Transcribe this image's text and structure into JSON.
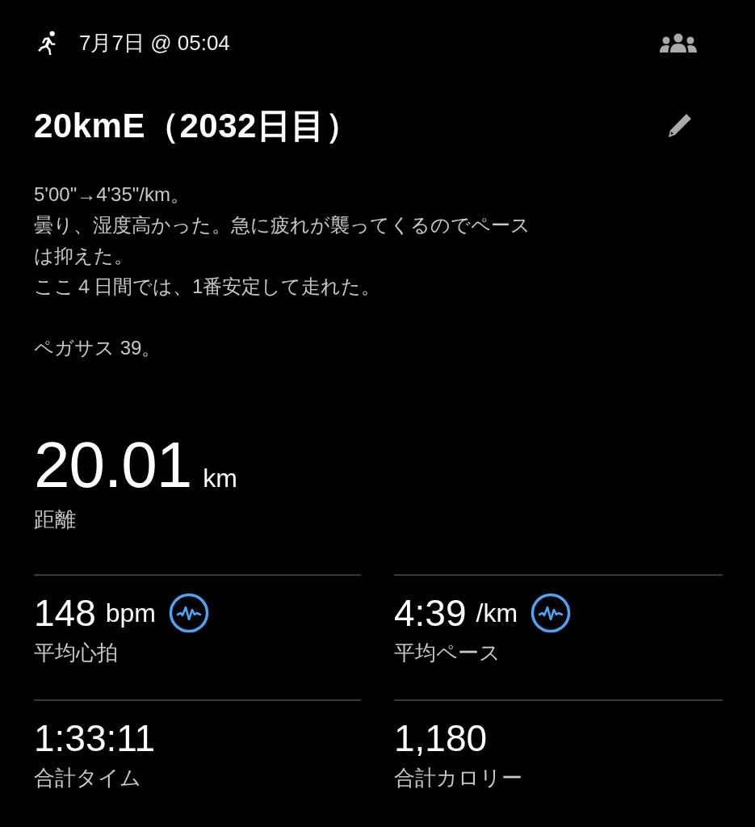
{
  "header": {
    "date": "7月7日 @ 05:04"
  },
  "title": "20kmE（2032日目）",
  "notes": [
    "5'00\"→4'35\"/km。",
    "曇り、湿度高かった。急に疲れが襲ってくるのでペース",
    "は抑えた。",
    "ここ４日間では、1番安定して走れた。"
  ],
  "shoe_note": "ペガサス 39。",
  "distance": {
    "value": "20.01",
    "unit": "km",
    "label": "距離"
  },
  "stats": [
    {
      "kind": "chart",
      "value": "148",
      "unit": "bpm",
      "label": "平均心拍"
    },
    {
      "kind": "chart",
      "value": "4:39",
      "unit": "/km",
      "label": "平均ペース"
    },
    {
      "kind": "plain",
      "value": "1:33:11",
      "label": "合計タイム"
    },
    {
      "kind": "plain",
      "value": "1,180",
      "label": "合計カロリー"
    }
  ]
}
